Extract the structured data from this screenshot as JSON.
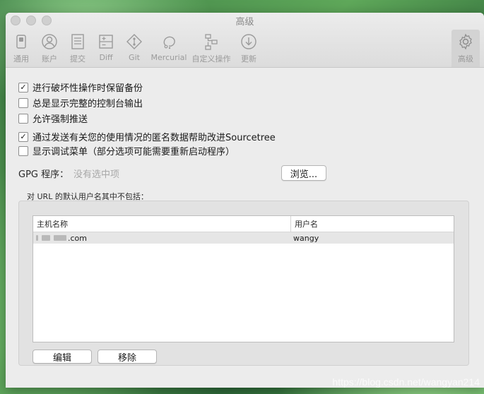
{
  "window": {
    "title": "高级"
  },
  "toolbar": {
    "items": [
      {
        "label": "通用",
        "icon": "switch-icon"
      },
      {
        "label": "账户",
        "icon": "account-icon"
      },
      {
        "label": "提交",
        "icon": "commit-icon"
      },
      {
        "label": "Diff",
        "icon": "diff-icon"
      },
      {
        "label": "Git",
        "icon": "git-icon"
      },
      {
        "label": "Mercurial",
        "icon": "mercurial-icon"
      },
      {
        "label": "自定义操作",
        "icon": "custom-actions-icon"
      },
      {
        "label": "更新",
        "icon": "update-icon"
      },
      {
        "label": "高级",
        "icon": "gear-icon",
        "active": true
      }
    ]
  },
  "options": [
    {
      "label": "进行破坏性操作时保留备份",
      "checked": true
    },
    {
      "label": "总是显示完整的控制台输出",
      "checked": false
    },
    {
      "label": "允许强制推送",
      "checked": false
    },
    {
      "label": "通过发送有关您的使用情况的匿名数据帮助改进Sourcetree",
      "checked": true
    },
    {
      "label": "显示调试菜单（部分选项可能需要重新启动程序）",
      "checked": false
    }
  ],
  "check_mark": "✓",
  "gpg": {
    "label": "GPG 程序：",
    "value": "没有选中项",
    "browse_label": "浏览..."
  },
  "url_exclusions": {
    "label": "对 URL 的默认用户名其中不包括：",
    "columns": [
      "主机名称",
      "用户名"
    ],
    "rows": [
      {
        "host_suffix": ".com",
        "username": "wangy"
      }
    ],
    "edit_label": "编辑",
    "remove_label": "移除"
  },
  "watermark": "https://blog.csdn.net/wangyan214"
}
